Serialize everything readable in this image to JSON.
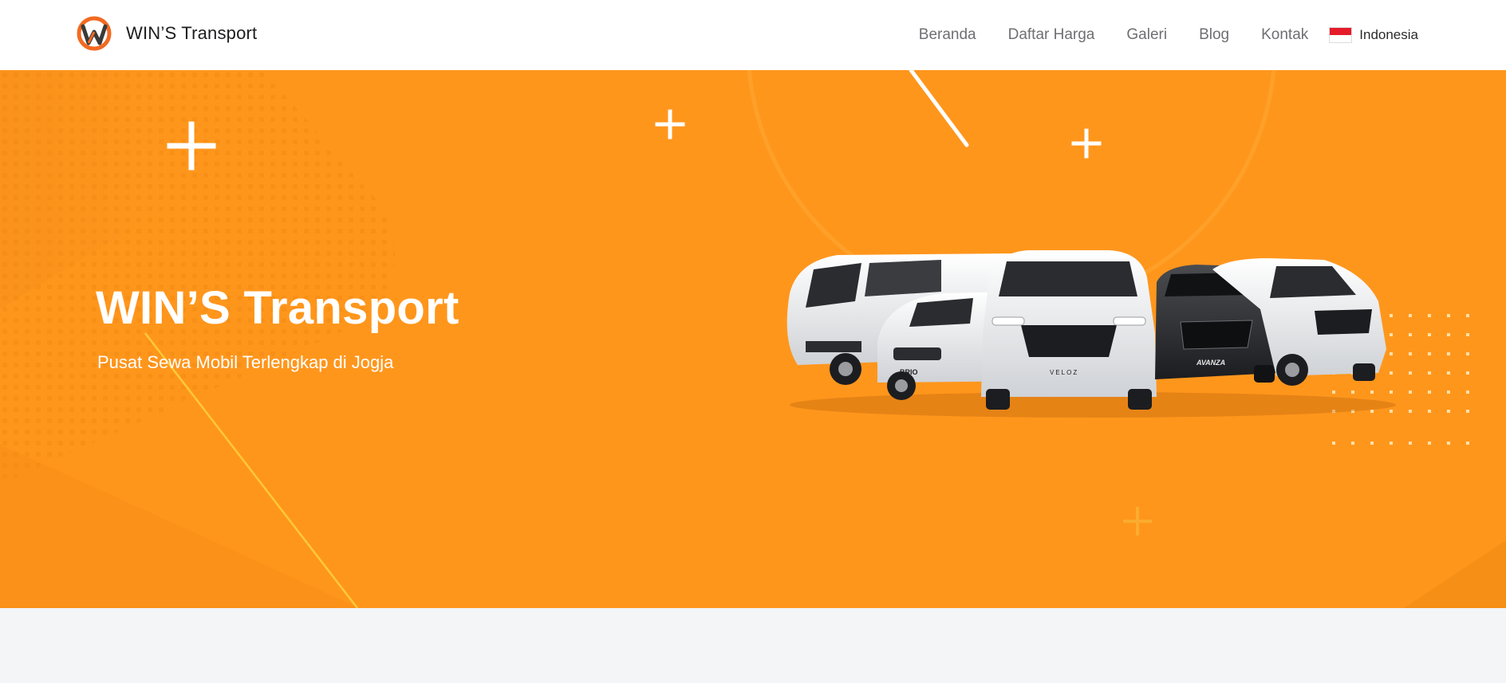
{
  "brand": {
    "name": "WIN’S Transport",
    "logo_icon": "wins-transport-logo-icon",
    "logo_letter": "W",
    "colors": {
      "logo_orange": "#f26a21",
      "logo_dark": "#3a3a3a"
    }
  },
  "nav": {
    "items": [
      {
        "label": "Beranda"
      },
      {
        "label": "Daftar Harga"
      },
      {
        "label": "Galeri"
      },
      {
        "label": "Blog"
      },
      {
        "label": "Kontak"
      }
    ],
    "language": {
      "label": "Indonesia",
      "flag_icon": "indonesia-flag-icon",
      "flag_colors": [
        "#e51b2a",
        "#ffffff"
      ]
    }
  },
  "hero": {
    "title": "WIN’S Transport",
    "subtitle": "Pusat Sewa Mobil Terlengkap di Jogja",
    "background_color": "#ff961c",
    "image_icon": "car-lineup-image",
    "car_badges": [
      "BRIO",
      "VELOZ",
      "AVANZA"
    ]
  }
}
